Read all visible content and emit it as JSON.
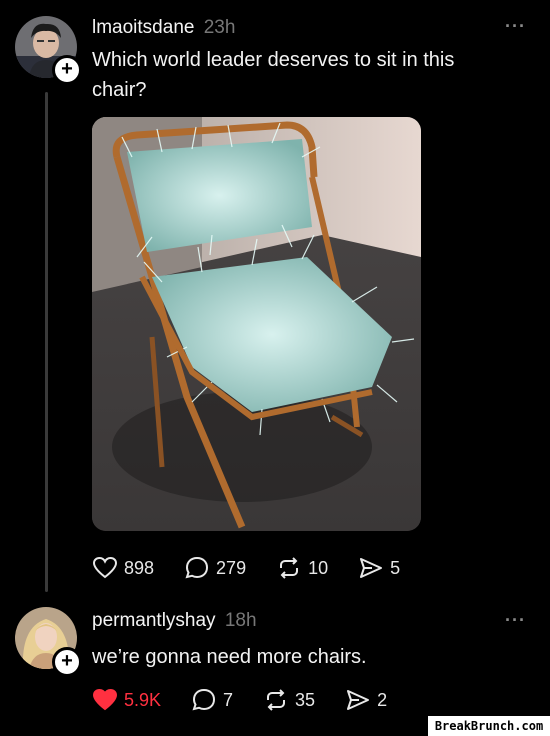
{
  "post": {
    "username": "lmaoitsdane",
    "time": "23h",
    "text_line1": "Which world leader deserves to sit in this",
    "text_line2": "chair?",
    "likes": "898",
    "comments": "279",
    "reposts": "10",
    "shares": "5"
  },
  "reply": {
    "username": "permantlyshay",
    "time": "18h",
    "text": "we’re gonna need more chairs.",
    "likes": "5.9K",
    "comments": "7",
    "reposts": "35",
    "shares": "2"
  },
  "icons": {
    "more": "more-dots-icon",
    "follow": "plus-icon",
    "like": "heart-icon",
    "comment": "comment-bubble-icon",
    "repost": "repost-icon",
    "share": "send-icon"
  },
  "colors": {
    "background": "#000000",
    "liked": "#ff3040",
    "muted": "#777777"
  },
  "watermark": "BreakBrunch.com"
}
